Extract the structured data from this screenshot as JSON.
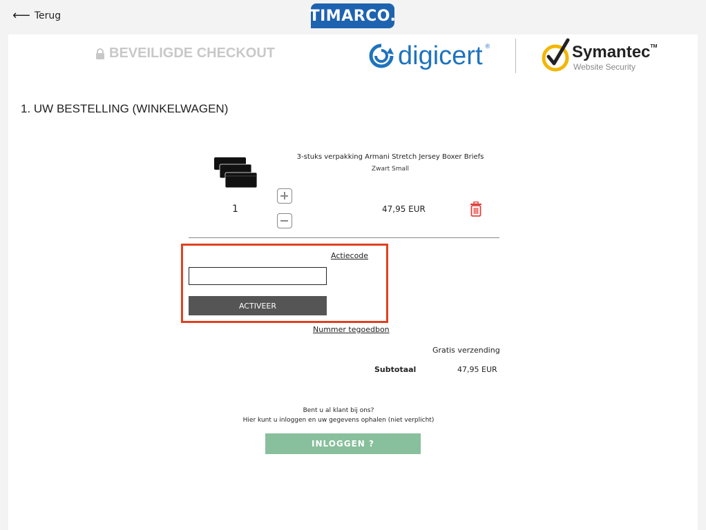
{
  "header": {
    "back_label": "Terug",
    "logo_text": "TIMARCO."
  },
  "trust": {
    "secure_title": "BEVEILIGDE CHECKOUT",
    "digicert_name": "digicert",
    "digicert_reg": "®",
    "symantec_name": "Symantec",
    "symantec_tm": "TM",
    "symantec_sub": "Website Security"
  },
  "order": {
    "section_title": "1. UW BESTELLING (WINKELWAGEN)",
    "item": {
      "name": "3-stuks verpakking Armani Stretch Jersey Boxer Briefs",
      "variant": "Zwart Small",
      "quantity": "1",
      "price": "47,95 EUR"
    }
  },
  "promo": {
    "actiecode_label": "Actiecode",
    "input_value": "",
    "activate_label": "ACTIVEER",
    "voucher_label": "Nummer tegoedbon"
  },
  "summary": {
    "shipping": "Gratis verzending",
    "subtotal_label": "Subtotaal",
    "subtotal_value": "47,95 EUR"
  },
  "login": {
    "question": "Bent u al klant bij ons?",
    "subtitle": "Hier kunt u inloggen en uw gegevens ophalen (niet verplicht)",
    "button_label": "INLOGGEN ?"
  },
  "colors": {
    "promo_highlight": "#e0401e",
    "login_button": "#88bf9c",
    "brand": "#1e63b0"
  }
}
